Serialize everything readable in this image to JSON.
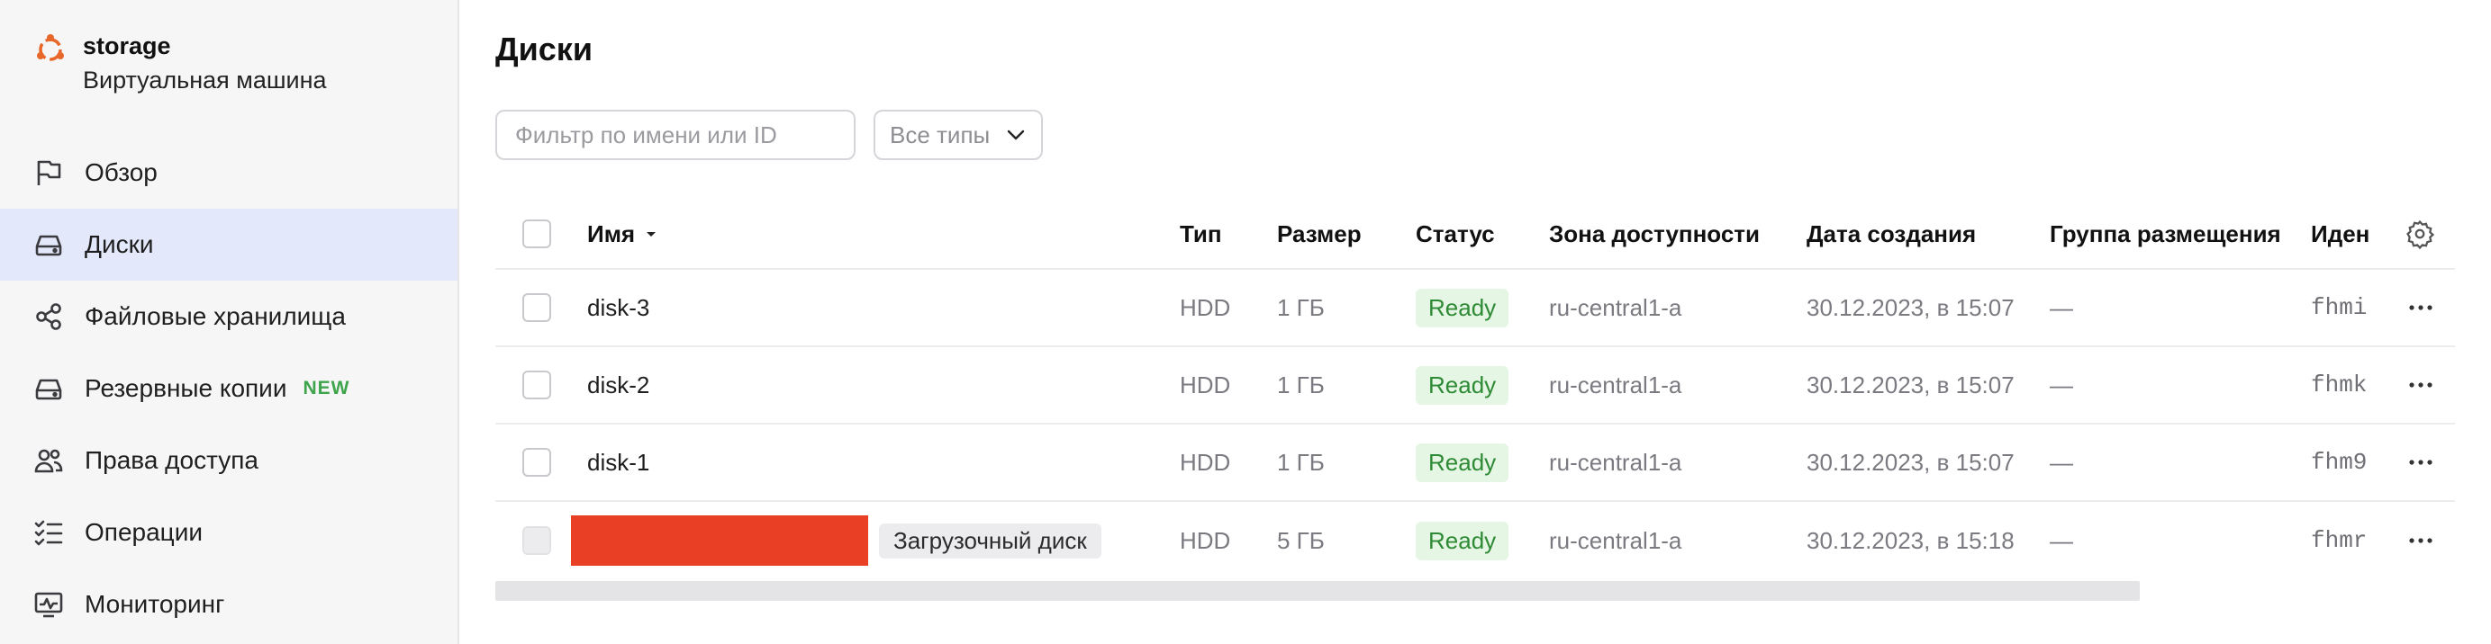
{
  "resource": {
    "name": "storage",
    "type": "Виртуальная машина"
  },
  "sidebar": {
    "items": [
      {
        "label": "Обзор",
        "icon": "flag-icon",
        "active": false
      },
      {
        "label": "Диски",
        "icon": "disk-icon",
        "active": true
      },
      {
        "label": "Файловые хранилища",
        "icon": "share-nodes-icon",
        "active": false
      },
      {
        "label": "Резервные копии",
        "icon": "backup-drive-icon",
        "active": false,
        "badge": "NEW"
      },
      {
        "label": "Права доступа",
        "icon": "users-icon",
        "active": false
      },
      {
        "label": "Операции",
        "icon": "list-checks-icon",
        "active": false
      },
      {
        "label": "Мониторинг",
        "icon": "monitor-chart-icon",
        "active": false
      }
    ]
  },
  "page": {
    "title": "Диски",
    "filter_placeholder": "Фильтр по имени или ID",
    "type_select_value": "Все типы"
  },
  "table": {
    "columns": {
      "name": "Имя",
      "type": "Тип",
      "size": "Размер",
      "status": "Статус",
      "zone": "Зона доступности",
      "created": "Дата создания",
      "placement": "Группа размещения",
      "id": "Иден"
    },
    "rows": [
      {
        "name": "disk-3",
        "type": "HDD",
        "size": "1 ГБ",
        "status": "Ready",
        "zone": "ru-central1-a",
        "created": "30.12.2023, в 15:07",
        "placement": "—",
        "id": "fhmi"
      },
      {
        "name": "disk-2",
        "type": "HDD",
        "size": "1 ГБ",
        "status": "Ready",
        "zone": "ru-central1-a",
        "created": "30.12.2023, в 15:07",
        "placement": "—",
        "id": "fhmk"
      },
      {
        "name": "disk-1",
        "type": "HDD",
        "size": "1 ГБ",
        "status": "Ready",
        "zone": "ru-central1-a",
        "created": "30.12.2023, в 15:07",
        "placement": "—",
        "id": "fhm9"
      },
      {
        "name": "",
        "boot_badge": "Загрузочный диск",
        "type": "HDD",
        "size": "5 ГБ",
        "status": "Ready",
        "zone": "ru-central1-a",
        "created": "30.12.2023, в 15:18",
        "placement": "—",
        "id": "fhmr"
      }
    ]
  },
  "colors": {
    "accent_active": "#e4e8fb",
    "brand": "#e8672b",
    "status_ready_bg": "#e5f6e4",
    "status_ready_text": "#2e8a35",
    "badge_new": "#3ea54c",
    "redaction": "#e94025"
  }
}
